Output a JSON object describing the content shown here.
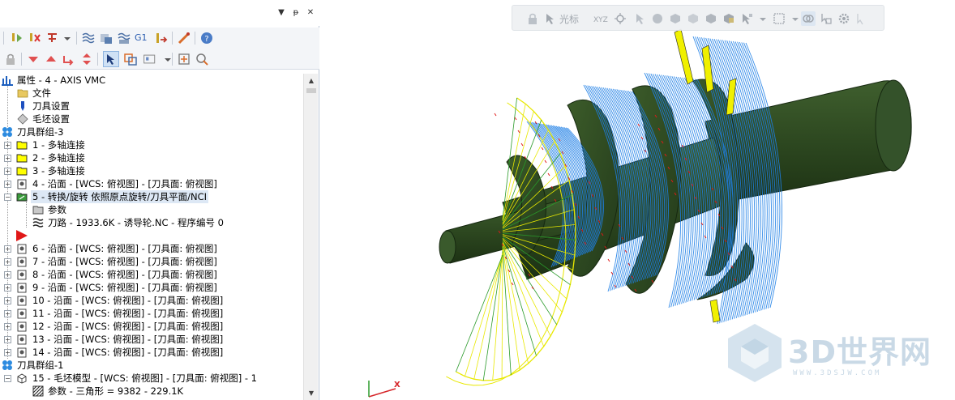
{
  "panel": {
    "pin_icon": "pin-icon",
    "dropdown_icon": "dropdown-arrow-icon",
    "close_icon": "close-icon"
  },
  "toolbar": {
    "g1_label": "G1"
  },
  "tree": {
    "root": "属性 - 4 - AXIS VMC",
    "files": "文件",
    "tool_settings": "刀具设置",
    "stock_settings": "毛坯设置",
    "group3": "刀具群组-3",
    "ops": [
      "1 - 多轴连接",
      "2 - 多轴连接",
      "3 - 多轴连接",
      "4 - 沿面 - [WCS: 俯视图] - [刀具面: 俯视图]",
      "5 - 转换/旋转 依照原点旋转/刀具平面/NCI"
    ],
    "op5_params": "参数",
    "op5_toolpath": "刀路 - 1933.6K - 诱导轮.NC - 程序编号 0",
    "ops_after": [
      "6 - 沿面 - [WCS: 俯视图] - [刀具面: 俯视图]",
      "7 - 沿面 - [WCS: 俯视图] - [刀具面: 俯视图]",
      "8 - 沿面 - [WCS: 俯视图] - [刀具面: 俯视图]",
      "9 - 沿面 - [WCS: 俯视图] - [刀具面: 俯视图]",
      "10 - 沿面 - [WCS: 俯视图] - [刀具面: 俯视图]",
      "11 - 沿面 - [WCS: 俯视图] - [刀具面: 俯视图]",
      "12 - 沿面 - [WCS: 俯视图] - [刀具面: 俯视图]",
      "13 - 沿面 - [WCS: 俯视图] - [刀具面: 俯视图]",
      "14 - 沿面 - [WCS: 俯视图] - [刀具面: 俯视图]"
    ],
    "group1": "刀具群组-1",
    "op15": "15 - 毛坯模型 - [WCS: 俯视图] - [刀具面: 俯视图] - 1",
    "op15_params": "参数 - 三角形 =  9382 - 229.1K"
  },
  "viewport": {
    "cursor_label": "光标",
    "xyz_label": "XYZ",
    "axis_x_label": "X",
    "watermark_text": "3D世界网",
    "watermark_url": "WWW.3DSJW.COM"
  },
  "colors": {
    "model": "#2f4a22",
    "toolpath_blue": "#1e7fe6",
    "toolpath_yellow": "#f0f000",
    "insert_marker": "#e01818"
  }
}
